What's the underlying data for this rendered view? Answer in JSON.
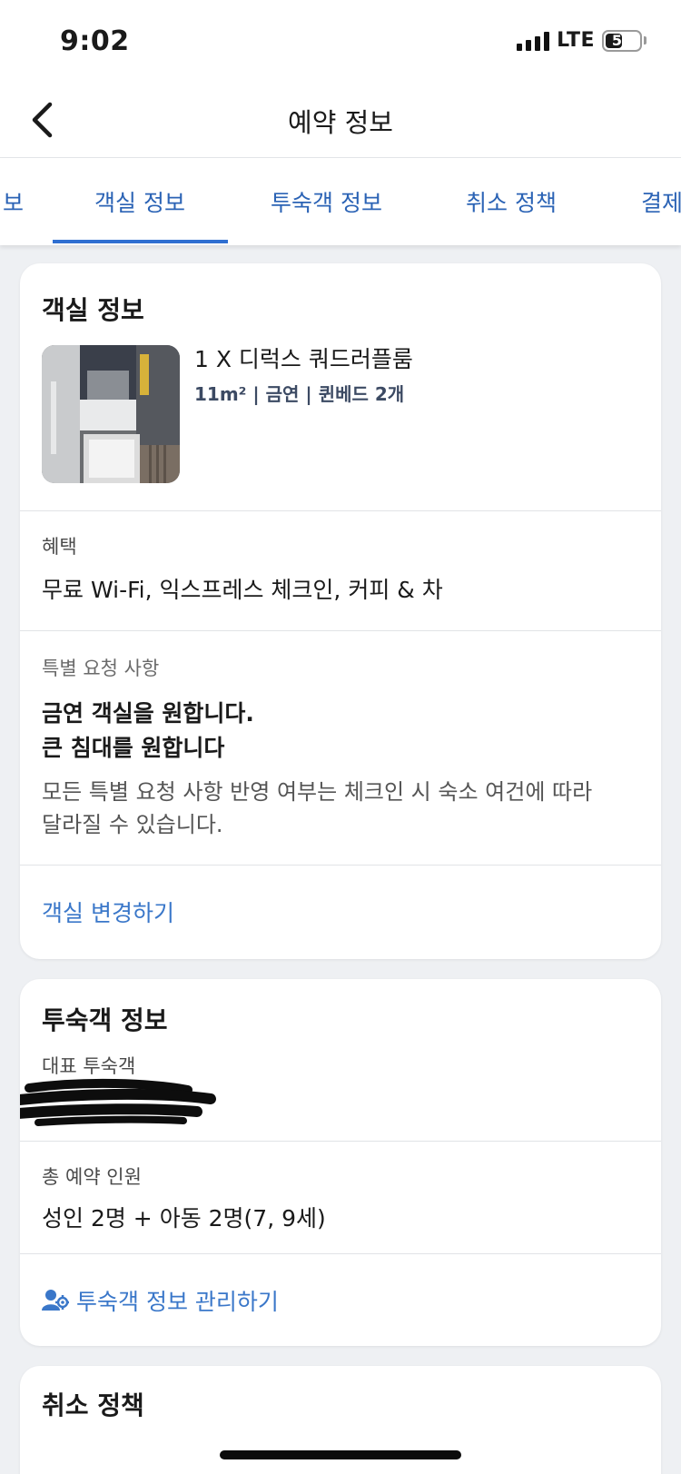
{
  "status_bar": {
    "time": "9:02",
    "network": "LTE",
    "battery": "51",
    "battery_level": 0.51
  },
  "nav": {
    "title": "예약 정보",
    "back_icon": "chevron-left-icon"
  },
  "tabs": [
    {
      "label": "요금 정보",
      "active": false
    },
    {
      "label": "객실 정보",
      "active": true
    },
    {
      "label": "투숙객 정보",
      "active": false
    },
    {
      "label": "취소 정책",
      "active": false
    },
    {
      "label": "결제 정보",
      "active": false
    }
  ],
  "room_card": {
    "title": "객실 정보",
    "room_name": "1 X 디럭스 쿼드러플룸",
    "room_details": "11m² | 금연 | 퀸베드 2개",
    "benefits_label": "혜택",
    "benefits_text": "무료 Wi-Fi, 익스프레스 체크인, 커피 & 차",
    "special_label": "특별 요청 사항",
    "special_req_1": "금연 객실을 원합니다.",
    "special_req_2": "큰 침대를 원합니다",
    "special_note_1": "모든 특별 요청 사항 반영 여부는 체크인 시 숙소 여건에 따라",
    "special_note_2": "달라질 수 있습니다.",
    "change_link": "객실 변경하기"
  },
  "guest_card": {
    "title": "투숙객 정보",
    "primary_label": "대표 투숙객",
    "total_label": "총 예약 인원",
    "total_value": "성인 2명 + 아동 2명(7, 9세)",
    "manage_link": "투숙객 정보 관리하기",
    "manage_icon": "user-gear-icon"
  },
  "cancel_card": {
    "title": "취소 정책"
  },
  "colors": {
    "accent": "#2f6fd1",
    "link": "#3a77c9",
    "background": "#eef0f3"
  }
}
